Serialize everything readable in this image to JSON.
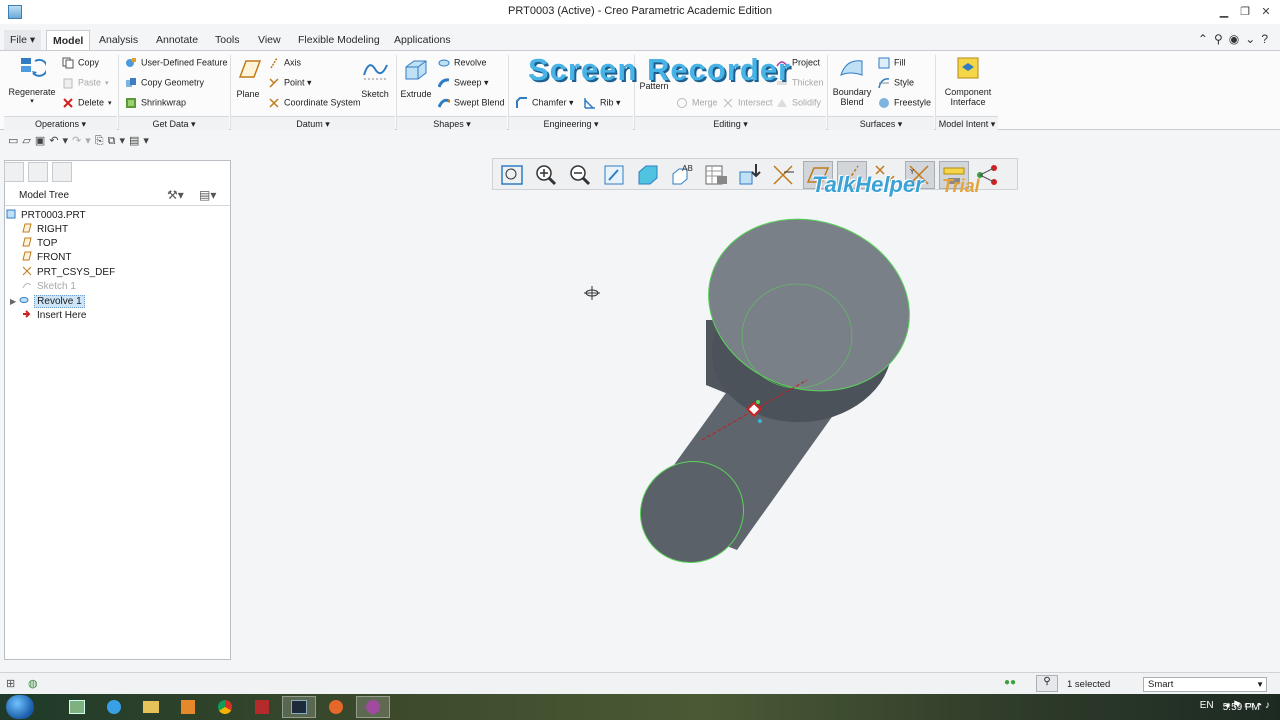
{
  "window": {
    "title": "PRT0003 (Active) - Creo Parametric Academic Edition",
    "minimize": "▁",
    "maximize": "❐",
    "close": "✕"
  },
  "tabs": {
    "file": "File ▾",
    "items": [
      "Model",
      "Analysis",
      "Annotate",
      "Tools",
      "View",
      "Flexible Modeling",
      "Applications"
    ],
    "active": "Model"
  },
  "ribbon": {
    "operations": {
      "regenerate": "Regenerate",
      "copy": "Copy",
      "paste": "Paste",
      "delete": "Delete",
      "label": "Operations ▾"
    },
    "get_data": {
      "udf": "User-Defined Feature",
      "copy_geometry": "Copy Geometry",
      "shrinkwrap": "Shrinkwrap",
      "label": "Get Data ▾"
    },
    "datum": {
      "plane": "Plane",
      "axis": "Axis",
      "point": "Point ▾",
      "csys": "Coordinate System",
      "sketch": "Sketch",
      "label": "Datum ▾"
    },
    "shapes": {
      "extrude": "Extrude",
      "revolve": "Revolve",
      "sweep": "Sweep ▾",
      "swept_blend": "Swept Blend",
      "label": "Shapes ▾"
    },
    "engineering": {
      "chamfer": "Chamfer ▾",
      "rib": "Rib ▾",
      "label": "Engineering ▾"
    },
    "editing": {
      "pattern": "Pattern",
      "merge": "Merge",
      "intersect": "Intersect",
      "project": "Project",
      "thicken": "Thicken",
      "solidify": "Solidify",
      "label": "Editing ▾"
    },
    "surfaces": {
      "boundary_blend": "Boundary Blend",
      "fill": "Fill",
      "style": "Style",
      "freestyle": "Freestyle",
      "label": "Surfaces ▾"
    },
    "model_intent": {
      "component_interface": "Component Interface",
      "label": "Model Intent ▾"
    }
  },
  "model_tree": {
    "title": "Model Tree",
    "items": [
      {
        "label": "PRT0003.PRT",
        "icon": "part-icon"
      },
      {
        "label": "RIGHT",
        "icon": "datum-plane-icon"
      },
      {
        "label": "TOP",
        "icon": "datum-plane-icon"
      },
      {
        "label": "FRONT",
        "icon": "datum-plane-icon"
      },
      {
        "label": "PRT_CSYS_DEF",
        "icon": "csys-icon"
      },
      {
        "label": "Sketch 1",
        "icon": "sketch-icon",
        "disabled": true
      },
      {
        "label": "Revolve 1",
        "icon": "revolve-icon",
        "selected": true
      },
      {
        "label": "Insert Here",
        "icon": "insert-arrow-icon"
      }
    ]
  },
  "watermark": {
    "line1": "TalkHelper",
    "trial": "Trial",
    "line2": "Screen Recorder"
  },
  "status": {
    "selected": "1 selected",
    "filter": "Smart"
  },
  "taskbar": {
    "language": "EN",
    "time": "5:59 PM"
  },
  "colors": {
    "model_fill": "#6c727a",
    "edge_highlight": "#56d256",
    "accent": "#3b7fb5"
  }
}
